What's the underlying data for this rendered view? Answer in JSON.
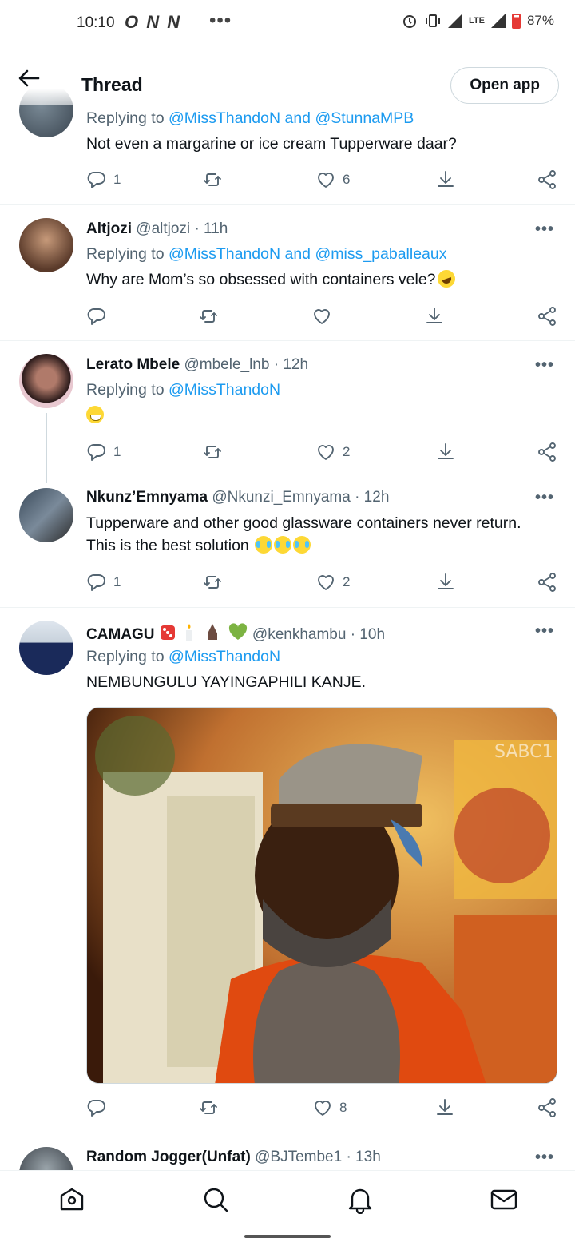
{
  "status_bar": {
    "time": "10:10",
    "left_icons": "O N N",
    "dots": "•••",
    "network": "LTE",
    "battery": "87%"
  },
  "header": {
    "title": "Thread",
    "open_app_label": "Open app"
  },
  "tweets": [
    {
      "name": "",
      "handle": "",
      "time": "",
      "replying_prefix": "Replying to",
      "replying_to": "@MissThandoN and @StunnaMPB",
      "text": "Not even a margarine or ice cream Tupperware daar?",
      "replies": "1",
      "retweets": "",
      "likes": "6"
    },
    {
      "name": "Altjozi",
      "handle": "@altjozi",
      "time": "· 11h",
      "replying_prefix": "Replying to",
      "replying_to": "@MissThandoN and @miss_paballeaux",
      "text": "Why are Mom’s so obsessed with containers vele?",
      "replies": "",
      "retweets": "",
      "likes": ""
    },
    {
      "name": "Lerato Mbele",
      "handle": "@mbele_lnb",
      "time": "· 12h",
      "replying_prefix": "Replying to",
      "replying_to": "@MissThandoN",
      "text": "",
      "replies": "1",
      "retweets": "",
      "likes": "2"
    },
    {
      "name": "Nkunz’Emnyama",
      "handle": "@Nkunzi_Emnyama",
      "time": "· 12h",
      "replying_prefix": "",
      "replying_to": "",
      "text_line1": "Tupperware and other good glassware containers never return.",
      "text_line2": "This is the best solution",
      "replies": "1",
      "retweets": "",
      "likes": "2"
    },
    {
      "name": "CAMAGU",
      "handle": "@kenkhambu",
      "time": "· 10h",
      "replying_prefix": "Replying to",
      "replying_to": "@MissThandoN",
      "text": "NEMBUNGULU YAYINGAPHILI KANJE.",
      "media_watermark": "SABC1",
      "replies": "",
      "retweets": "",
      "likes": "8"
    },
    {
      "name": "Random Jogger(Unfat)",
      "handle": "@BJTembe1",
      "time": "· 13h"
    }
  ],
  "more_label": "•••",
  "bottom_nav": {
    "items": [
      "home-icon",
      "search-icon",
      "notifications-icon",
      "messages-icon"
    ]
  },
  "colors": {
    "accent": "#1d9bf0",
    "text": "#0f1419",
    "secondary": "#536471",
    "divider": "#eff3f4"
  }
}
